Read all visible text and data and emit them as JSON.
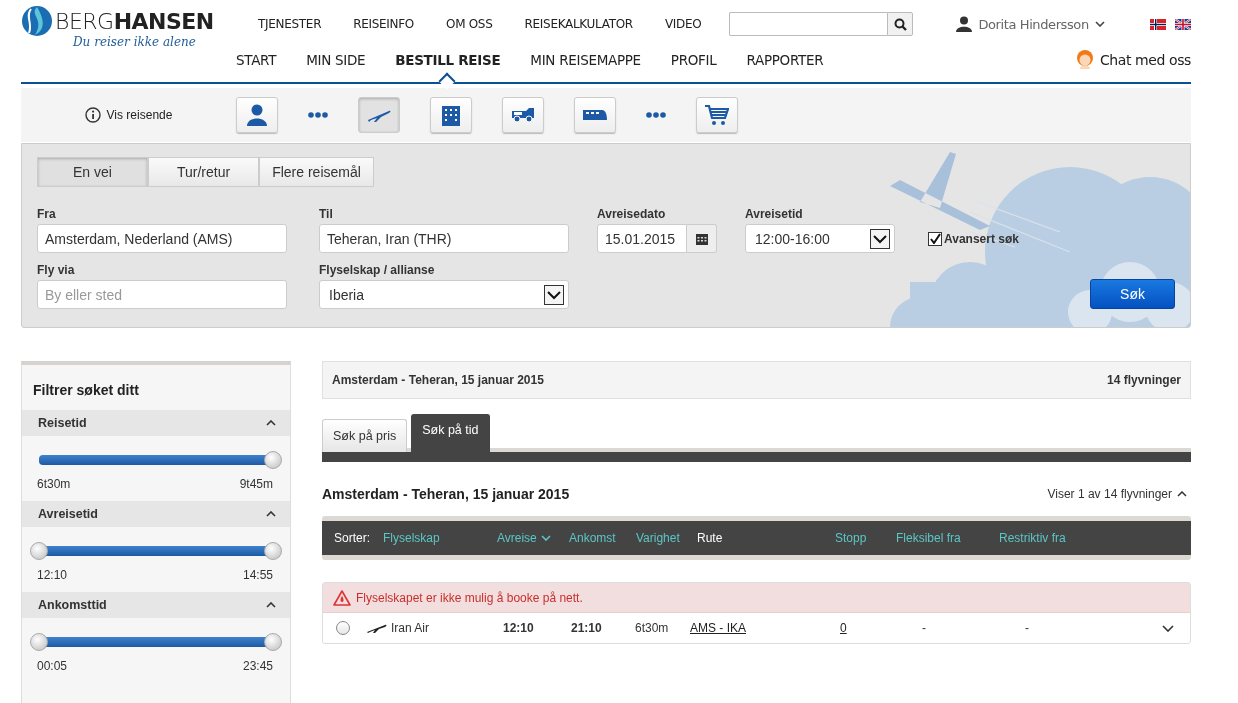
{
  "header": {
    "logo": "BERG**HANSEN**",
    "tagline": "Du reiser ikke alene",
    "top_nav": [
      "TJENESTER",
      "REISEINFO",
      "OM OSS",
      "REISEKALKULATOR",
      "VIDEO"
    ],
    "user": "Dorita Hindersson",
    "main_nav": [
      {
        "label": "START",
        "selected": false
      },
      {
        "label": "MIN SIDE",
        "selected": false
      },
      {
        "label": "BESTILL REISE",
        "selected": true
      },
      {
        "label": "MIN REISEMAPPE",
        "selected": false
      },
      {
        "label": "PROFIL",
        "selected": false
      },
      {
        "label": "RAPPORTER",
        "selected": false
      }
    ],
    "chat": "Chat med oss"
  },
  "toolbar": {
    "info": "Vis reisende",
    "items": [
      {
        "kind": "traveller",
        "selected": false
      },
      {
        "kind": "more",
        "selected": false
      },
      {
        "kind": "flight",
        "selected": true
      },
      {
        "kind": "hotel",
        "selected": false
      },
      {
        "kind": "car",
        "selected": false
      },
      {
        "kind": "train",
        "selected": false
      },
      {
        "kind": "more",
        "selected": false
      },
      {
        "kind": "cart",
        "selected": false
      }
    ]
  },
  "search_form": {
    "trip_types": [
      {
        "label": "En vei",
        "selected": true
      },
      {
        "label": "Tur/retur",
        "selected": false
      },
      {
        "label": "Flere reisemål",
        "selected": false
      }
    ],
    "from": {
      "label": "Fra",
      "value": "Amsterdam, Nederland (AMS)"
    },
    "to": {
      "label": "Til",
      "value": "Teheran, Iran (THR)"
    },
    "date": {
      "label": "Avreisedato",
      "value": "15.01.2015"
    },
    "time": {
      "label": "Avreisetid",
      "value": "12:00-16:00"
    },
    "advanced": {
      "label": "Avansert søk",
      "checked": true
    },
    "via": {
      "label": "Fly via",
      "placeholder": "By eller sted"
    },
    "airline": {
      "label": "Flyselskap / allianse",
      "value": "Iberia"
    },
    "submit": "Søk"
  },
  "filters": {
    "title": "Filtrer søket ditt",
    "sections": [
      {
        "title": "Reisetid",
        "expanded": true,
        "thumbs": [
          {
            "level": 1
          }
        ],
        "min": "6t30m",
        "max": "9t45m"
      },
      {
        "title": "Avreisetid",
        "expanded": true,
        "thumbs": [
          {
            "level": 0
          },
          {
            "level": 1
          }
        ],
        "min": "12:10",
        "max": "14:55"
      },
      {
        "title": "Ankomsttid",
        "expanded": true,
        "thumbs": [
          {
            "level": 0
          },
          {
            "level": 1
          }
        ],
        "min": "00:05",
        "max": "23:45"
      }
    ]
  },
  "results": {
    "summary": "Amsterdam - Teheran, 15 januar 2015",
    "count": "14 flyvninger",
    "tabs": [
      {
        "label": "Søk på pris",
        "selected": false
      },
      {
        "label": "Søk på tid",
        "selected": true
      }
    ],
    "heading": "Amsterdam - Teheran, 15 januar 2015",
    "showing": "Viser 1 av 14 flyvninger",
    "sort_label": "Sorter:",
    "columns": [
      {
        "label": "Flyselskap",
        "sortable": true,
        "sorted": false
      },
      {
        "label": "Avreise",
        "sortable": true,
        "sorted": true
      },
      {
        "label": "Ankomst",
        "sortable": true,
        "sorted": false
      },
      {
        "label": "Varighet",
        "sortable": true,
        "sorted": false
      },
      {
        "label": "Rute",
        "sortable": false,
        "sorted": false
      },
      {
        "label": "Stopp",
        "sortable": true,
        "sorted": false
      },
      {
        "label": "Fleksibel fra",
        "sortable": true,
        "sorted": false
      },
      {
        "label": "Restriktiv fra",
        "sortable": true,
        "sorted": false
      }
    ],
    "alert": "Flyselskapet er ikke mulig å booke på nett.",
    "rows": [
      {
        "selected": false,
        "airline": "Iran Air",
        "departure": "12:10",
        "arrival": "21:10",
        "duration": "6t30m",
        "route": "AMS - IKA",
        "stops": "0",
        "flexible": "-",
        "restrictive": "-",
        "expanded": false
      }
    ]
  }
}
